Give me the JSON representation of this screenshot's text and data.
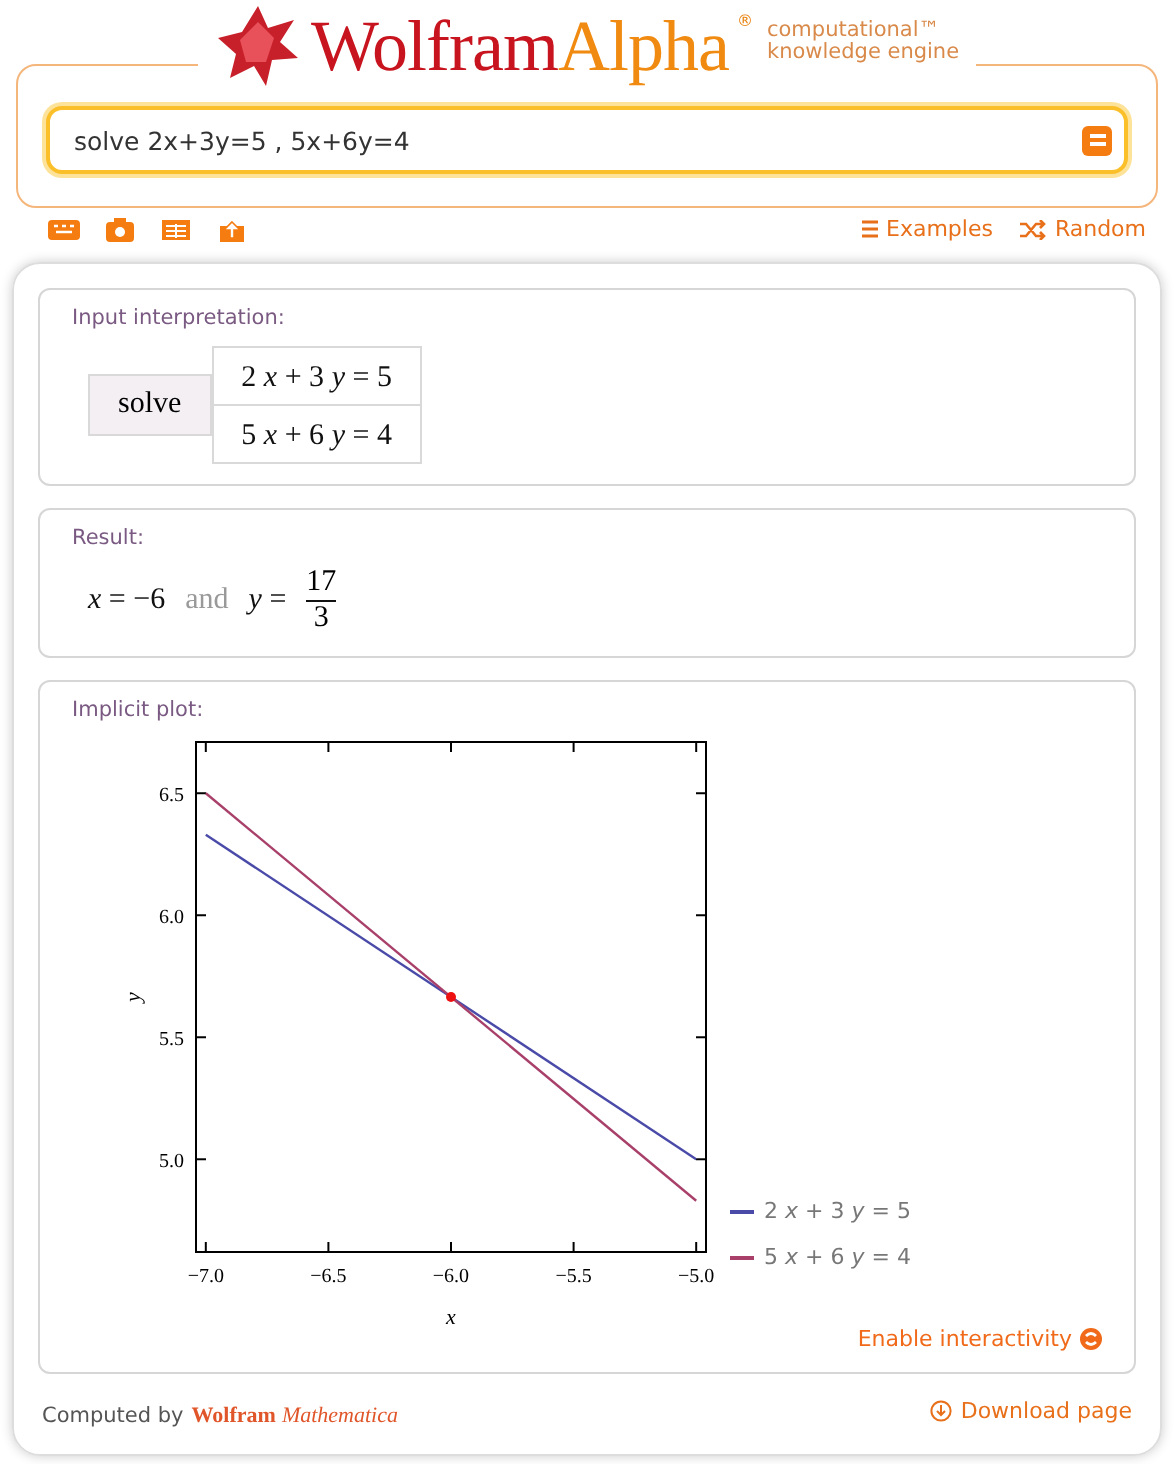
{
  "logo": {
    "word1": "Wolfram",
    "word2": "Alpha",
    "mark": "®",
    "tagline": [
      "computational™",
      "knowledge engine"
    ]
  },
  "search": {
    "value": "solve 2x+3y=5 , 5x+6y=4"
  },
  "links": [
    {
      "label": "Examples",
      "kind": "examples"
    },
    {
      "label": "Random",
      "kind": "random"
    }
  ],
  "pods": [
    {
      "kind": "interpretation",
      "title": "Input interpretation:",
      "command": "solve",
      "equations": [
        "2 *x* + 3 *y* = 5",
        "5 *x* + 6 *y* = 4"
      ]
    },
    {
      "kind": "result",
      "title": "Result:",
      "first": "*x* = −6",
      "joiner": "and",
      "second": "*y* =",
      "numerator": "17",
      "denominator": "3"
    },
    {
      "kind": "plot",
      "title": "Implicit plot:",
      "action": "Enable interactivity",
      "chart_data": {
        "type": "line",
        "xlabel": "x",
        "ylabel": "y",
        "x": [
          -7,
          -5
        ],
        "series": [
          {
            "name": "2 *x* + 3 *y* = 5",
            "color": "#4a4aa8",
            "values": [
              6.33,
              5.0
            ]
          },
          {
            "name": "5 *x* + 6 *y* = 4",
            "color": "#a8406a",
            "values": [
              6.5,
              4.83
            ]
          }
        ],
        "xlim": [
          -7.04,
          -4.96
        ],
        "ylim": [
          4.62,
          6.71
        ],
        "xticks": [
          {
            "value": -7,
            "label": "−7.0"
          },
          {
            "value": -6.5,
            "label": "−6.5"
          },
          {
            "value": -6,
            "label": "−6.0"
          },
          {
            "value": -5.5,
            "label": "−5.5"
          },
          {
            "value": -5,
            "label": "−5.0"
          }
        ],
        "yticks": [
          {
            "value": 5,
            "label": "5.0"
          },
          {
            "value": 5.5,
            "label": "5.5"
          },
          {
            "value": 6,
            "label": "6.0"
          },
          {
            "value": 6.5,
            "label": "6.5"
          }
        ]
      }
    }
  ],
  "footer": {
    "computed_by": "Computed by",
    "brand": "Wolfram",
    "product": "Mathematica",
    "download": "Download page"
  }
}
